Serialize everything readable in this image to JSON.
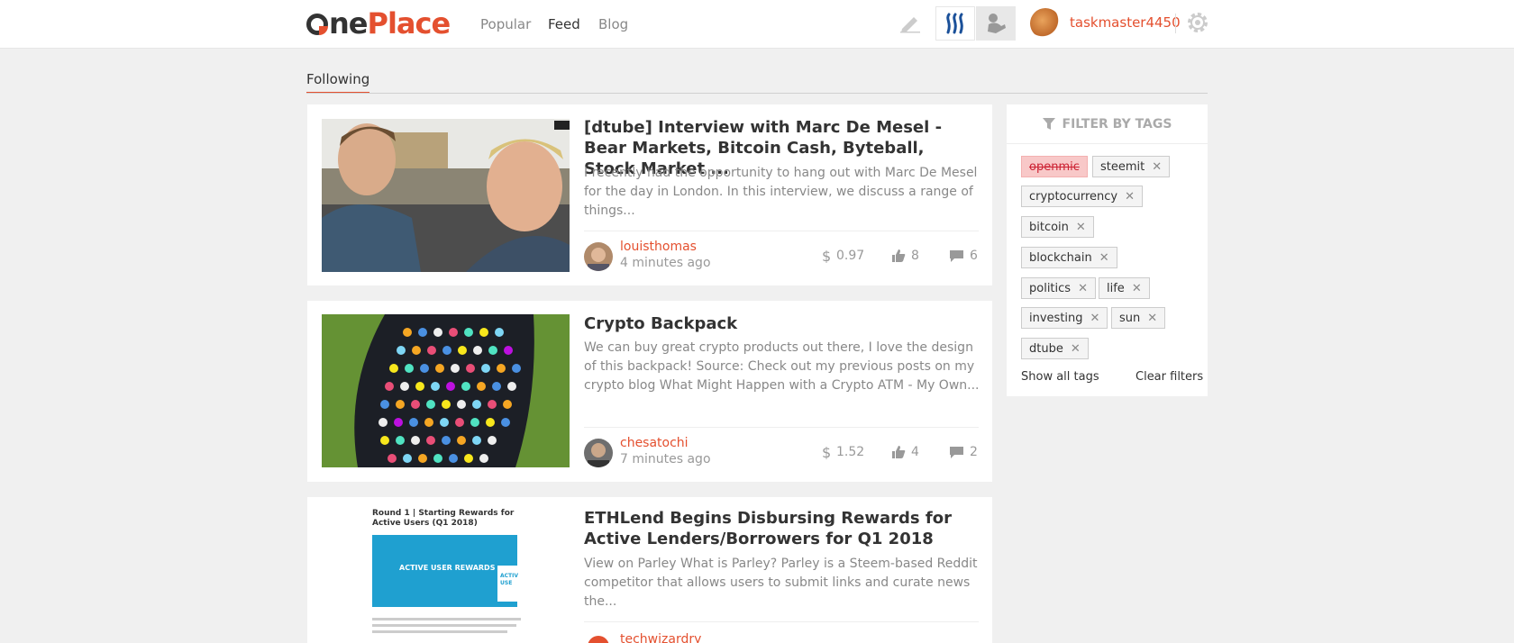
{
  "header": {
    "logo_one": "One",
    "logo_place": "Place",
    "nav": [
      "Popular",
      "Feed",
      "Blog"
    ],
    "active_nav": "Feed",
    "username": "taskmaster4450"
  },
  "tabs": {
    "following": "Following"
  },
  "posts": [
    {
      "title": "[dtube] Interview with Marc De Mesel - Bear Markets, Bitcoin Cash, Byteball, Stock Market ...",
      "excerpt": "I recently had the opportunity to hang out with Marc De Mesel for the day in London. In this interview, we discuss a range of things...",
      "author": "louisthomas",
      "time": "4 minutes ago",
      "payout": "0.97",
      "votes": "8",
      "comments": "6"
    },
    {
      "title": "Crypto Backpack",
      "excerpt": "We can buy great crypto products out there, I love the design of this backpack! Source: Check out my previous posts on my crypto blog What Might Happen with a Crypto ATM - My Own...",
      "author": "chesatochi",
      "time": "7 minutes ago",
      "payout": "1.52",
      "votes": "4",
      "comments": "2"
    },
    {
      "title": "ETHLend Begins Disbursing Rewards for Active Lenders/Borrowers for Q1 2018",
      "excerpt": "View on Parley What is Parley? Parley is a Steem-based Reddit competitor that allows users to submit links and curate news the...",
      "author": "techwizardry",
      "thumb_heading": "Round 1 | Starting Rewards for Active Users (Q1 2018)",
      "thumb_banner": "ACTIVE USER REWARDS",
      "thumb_side": "ACTIV USE"
    }
  ],
  "sidebar": {
    "heading": "FILTER BY TAGS",
    "tags": [
      {
        "label": "openmic",
        "excluded": true
      },
      {
        "label": "steemit"
      },
      {
        "label": "cryptocurrency"
      },
      {
        "label": "bitcoin"
      },
      {
        "label": "blockchain"
      },
      {
        "label": "politics"
      },
      {
        "label": "life"
      },
      {
        "label": "investing"
      },
      {
        "label": "sun"
      },
      {
        "label": "dtube"
      }
    ],
    "show_all": "Show all tags",
    "clear": "Clear filters"
  },
  "colors": {
    "accent": "#e4502f",
    "background": "#f0f0f0"
  }
}
